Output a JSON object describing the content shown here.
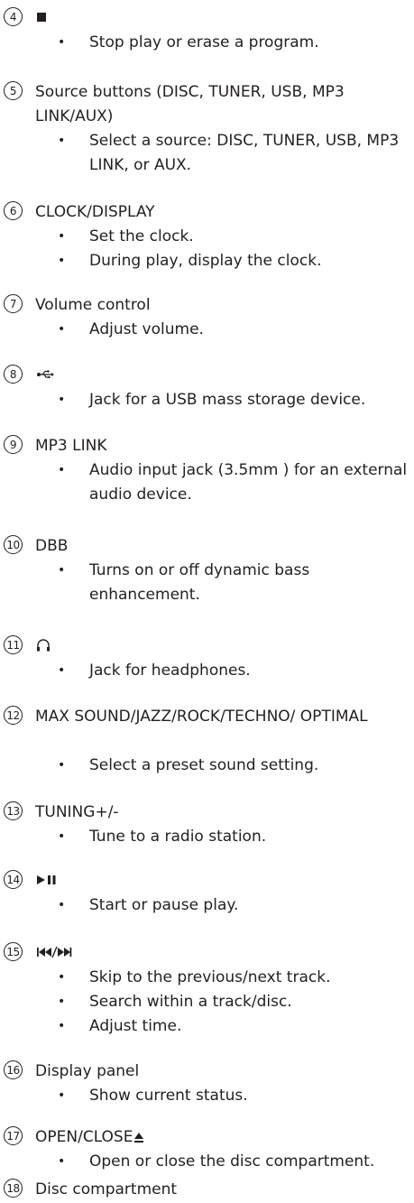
{
  "items": [
    {
      "num": "4",
      "title": "",
      "symbol": "stop-icon",
      "bullets": [
        "Stop play or erase a program."
      ]
    },
    {
      "num": "5",
      "title": "Source buttons (DISC, TUNER, USB, MP3 LINK/AUX)",
      "bullets": [
        "Select a source: DISC, TUNER, USB, MP3 LINK, or AUX."
      ]
    },
    {
      "num": "6",
      "title": "CLOCK/DISPLAY",
      "bullets": [
        "Set the clock.",
        "During play, display the clock."
      ]
    },
    {
      "num": "7",
      "title": "Volume control",
      "bullets": [
        "Adjust volume."
      ]
    },
    {
      "num": "8",
      "title": "",
      "symbol": "usb-icon",
      "bullets": [
        "Jack for a USB mass storage device."
      ]
    },
    {
      "num": "9",
      "title": "MP3 LINK",
      "bullets": [
        "Audio input jack (3.5mm ) for an external audio device."
      ]
    },
    {
      "num": "10",
      "title": "DBB",
      "bullets": [
        "Turns on or off dynamic bass enhancement."
      ]
    },
    {
      "num": "11",
      "title": "",
      "symbol": "headphones-icon",
      "bullets": [
        "Jack for headphones."
      ]
    },
    {
      "num": "12",
      "title": "MAX SOUND/JAZZ/ROCK/TECHNO/ OPTIMAL",
      "bullets": [
        "Select a preset sound setting."
      ]
    },
    {
      "num": "13",
      "title": "TUNING+/-",
      "bullets": [
        "Tune to a radio station."
      ]
    },
    {
      "num": "14",
      "title": "",
      "symbol": "play-pause-icon",
      "bullets": [
        "Start or pause play."
      ]
    },
    {
      "num": "15",
      "title": "",
      "symbol": "prev-next-icon",
      "bullets": [
        "Skip to the previous/next track.",
        "Search within a track/disc.",
        "Adjust time."
      ]
    },
    {
      "num": "16",
      "title": "Display panel",
      "bullets": [
        "Show current status."
      ]
    },
    {
      "num": "17",
      "title": "OPEN/CLOSE",
      "symbol": "eject-icon",
      "bullets": [
        "Open or close the disc compartment."
      ]
    },
    {
      "num": "18",
      "title": "Disc compartment",
      "bullets": []
    }
  ]
}
